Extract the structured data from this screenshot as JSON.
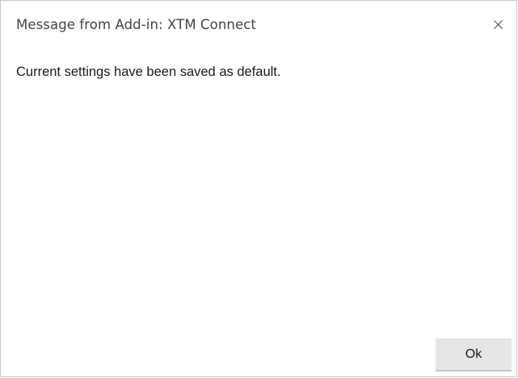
{
  "dialog": {
    "title": "Message from Add-in: XTM Connect",
    "close_icon": "close-icon",
    "message": "Current settings have been saved as default.",
    "ok_label": "Ok"
  },
  "colors": {
    "background": "#ffffff",
    "border": "#c8c8c8",
    "title_text": "#444444",
    "body_text": "#1a1a1a",
    "button_bg": "#e6e6e6"
  }
}
